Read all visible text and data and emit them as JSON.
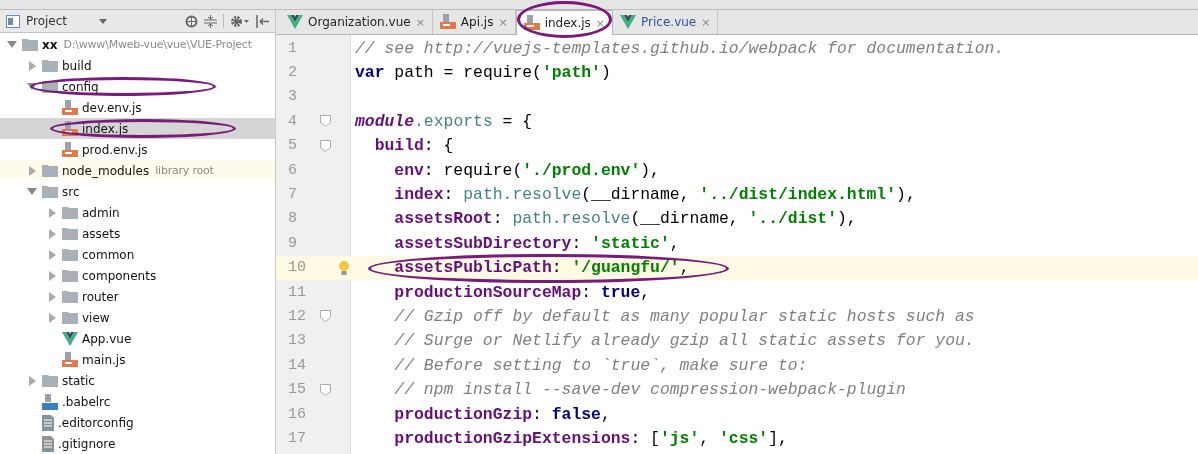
{
  "project_panel": {
    "title": "Project"
  },
  "tree": [
    {
      "name": "xx",
      "kind": "folder",
      "expanded": true,
      "selected": false,
      "circled": false,
      "note": "D:\\www\\Mweb-vue\\vue\\VUE-Project",
      "children": [
        {
          "name": "build",
          "kind": "folder",
          "expanded": false,
          "selected": false,
          "circled": false
        },
        {
          "name": "config",
          "kind": "folder",
          "expanded": true,
          "selected": false,
          "circled": true,
          "children": [
            {
              "name": "dev.env.js",
              "kind": "js",
              "selected": false,
              "circled": false
            },
            {
              "name": "index.js",
              "kind": "js",
              "selected": true,
              "circled": true
            },
            {
              "name": "prod.env.js",
              "kind": "js",
              "selected": false,
              "circled": false
            }
          ]
        },
        {
          "name": "node_modules",
          "kind": "folder",
          "expanded": false,
          "selected": false,
          "circled": false,
          "note": "library root"
        },
        {
          "name": "src",
          "kind": "folder",
          "expanded": true,
          "selected": false,
          "circled": false,
          "children": [
            {
              "name": "admin",
              "kind": "folder",
              "expanded": false,
              "selected": false,
              "circled": false
            },
            {
              "name": "assets",
              "kind": "folder",
              "expanded": false,
              "selected": false,
              "circled": false
            },
            {
              "name": "common",
              "kind": "folder",
              "expanded": false,
              "selected": false,
              "circled": false
            },
            {
              "name": "components",
              "kind": "folder",
              "expanded": false,
              "selected": false,
              "circled": false
            },
            {
              "name": "router",
              "kind": "folder",
              "expanded": false,
              "selected": false,
              "circled": false
            },
            {
              "name": "view",
              "kind": "folder",
              "expanded": false,
              "selected": false,
              "circled": false
            },
            {
              "name": "App.vue",
              "kind": "vue",
              "selected": false,
              "circled": false
            },
            {
              "name": "main.js",
              "kind": "js",
              "selected": false,
              "circled": false
            }
          ]
        },
        {
          "name": "static",
          "kind": "folder",
          "expanded": false,
          "selected": false,
          "circled": false
        },
        {
          "name": ".babelrc",
          "kind": "json",
          "selected": false,
          "circled": false
        },
        {
          "name": ".editorconfig",
          "kind": "text",
          "selected": false,
          "circled": false
        },
        {
          "name": ".gitignore",
          "kind": "text",
          "selected": false,
          "circled": false
        }
      ]
    }
  ],
  "tabs": [
    {
      "label": "Organization.vue",
      "kind": "vue",
      "selected": false,
      "circled": false,
      "close": "×"
    },
    {
      "label": "Api.js",
      "kind": "js",
      "selected": false,
      "circled": false,
      "close": "×"
    },
    {
      "label": "index.js",
      "kind": "js",
      "selected": true,
      "circled": true,
      "close": "×"
    },
    {
      "label": "Price.vue",
      "kind": "vue",
      "selected": false,
      "circled": false,
      "close": "×"
    }
  ],
  "code_lines": [
    {
      "number": "1",
      "current": false,
      "circled": false,
      "fold": false,
      "segments": [
        {
          "text": "// see http://vuejs-templates.github.io/webpack for documentation.",
          "kind": "comment"
        }
      ]
    },
    {
      "number": "2",
      "current": false,
      "circled": false,
      "fold": false,
      "segments": [
        {
          "text": "var",
          "kind": "keyword"
        },
        {
          "text": " path = require(",
          "kind": "plain"
        },
        {
          "text": "'path'",
          "kind": "string"
        },
        {
          "text": ")",
          "kind": "plain"
        }
      ]
    },
    {
      "number": "3",
      "current": false,
      "circled": false,
      "fold": false
    },
    {
      "number": "4",
      "current": false,
      "circled": false,
      "fold": true,
      "segments": [
        {
          "text": "module",
          "kind": "global"
        },
        {
          "text": ".exports",
          "kind": "member"
        },
        {
          "text": " = {",
          "kind": "plain"
        }
      ]
    },
    {
      "number": "5",
      "current": false,
      "circled": false,
      "fold": true,
      "segments": [
        {
          "text": "  build",
          "kind": "property"
        },
        {
          "text": ": {",
          "kind": "plain"
        }
      ]
    },
    {
      "number": "6",
      "current": false,
      "circled": false,
      "fold": false,
      "segments": [
        {
          "text": "    env",
          "kind": "property"
        },
        {
          "text": ": require(",
          "kind": "plain"
        },
        {
          "text": "'./prod.env'",
          "kind": "string"
        },
        {
          "text": "),",
          "kind": "plain"
        }
      ]
    },
    {
      "number": "7",
      "current": false,
      "circled": false,
      "fold": false,
      "segments": [
        {
          "text": "    index",
          "kind": "property"
        },
        {
          "text": ": ",
          "kind": "plain"
        },
        {
          "text": "path.resolve",
          "kind": "member"
        },
        {
          "text": "(__dirname, ",
          "kind": "plain"
        },
        {
          "text": "'../dist/index.html'",
          "kind": "string"
        },
        {
          "text": "),",
          "kind": "plain"
        }
      ]
    },
    {
      "number": "8",
      "current": false,
      "circled": false,
      "fold": false,
      "segments": [
        {
          "text": "    assetsRoot",
          "kind": "property"
        },
        {
          "text": ": ",
          "kind": "plain"
        },
        {
          "text": "path.resolve",
          "kind": "member"
        },
        {
          "text": "(__dirname, ",
          "kind": "plain"
        },
        {
          "text": "'../dist'",
          "kind": "string"
        },
        {
          "text": "),",
          "kind": "plain"
        }
      ]
    },
    {
      "number": "9",
      "current": false,
      "circled": false,
      "fold": false,
      "segments": [
        {
          "text": "    assetsSubDirectory",
          "kind": "property"
        },
        {
          "text": ": ",
          "kind": "plain"
        },
        {
          "text": "'static'",
          "kind": "string"
        },
        {
          "text": ",",
          "kind": "plain"
        }
      ]
    },
    {
      "number": "10",
      "current": true,
      "circled": true,
      "fold": false,
      "segments": [
        {
          "text": "    assetsPublicPath",
          "kind": "property"
        },
        {
          "text": ": ",
          "kind": "plain"
        },
        {
          "text": "'/guangfu/'",
          "kind": "string"
        },
        {
          "text": ",",
          "kind": "plain"
        }
      ]
    },
    {
      "number": "11",
      "current": false,
      "circled": false,
      "fold": false,
      "segments": [
        {
          "text": "    productionSourceMap",
          "kind": "property"
        },
        {
          "text": ": ",
          "kind": "plain"
        },
        {
          "text": "true",
          "kind": "keyword"
        },
        {
          "text": ",",
          "kind": "plain"
        }
      ]
    },
    {
      "number": "12",
      "current": false,
      "circled": false,
      "fold": true,
      "segments": [
        {
          "text": "    // Gzip off by default as many popular static hosts such as",
          "kind": "comment"
        }
      ]
    },
    {
      "number": "13",
      "current": false,
      "circled": false,
      "fold": false,
      "segments": [
        {
          "text": "    // Surge or Netlify already gzip all static assets for you.",
          "kind": "comment"
        }
      ]
    },
    {
      "number": "14",
      "current": false,
      "circled": false,
      "fold": false,
      "segments": [
        {
          "text": "    // Before setting to `true`, make sure to:",
          "kind": "comment"
        }
      ]
    },
    {
      "number": "15",
      "current": false,
      "circled": false,
      "fold": true,
      "segments": [
        {
          "text": "    // npm install --save-dev compression-webpack-plugin",
          "kind": "comment"
        }
      ]
    },
    {
      "number": "16",
      "current": false,
      "circled": false,
      "fold": false,
      "segments": [
        {
          "text": "    productionGzip",
          "kind": "property"
        },
        {
          "text": ": ",
          "kind": "plain"
        },
        {
          "text": "false",
          "kind": "keyword"
        },
        {
          "text": ",",
          "kind": "plain"
        }
      ]
    },
    {
      "number": "17",
      "current": false,
      "circled": false,
      "fold": false,
      "segments": [
        {
          "text": "    productionGzipExtensions",
          "kind": "property"
        },
        {
          "text": ": [",
          "kind": "plain"
        },
        {
          "text": "'js'",
          "kind": "string"
        },
        {
          "text": ", ",
          "kind": "plain"
        },
        {
          "text": "'css'",
          "kind": "string"
        },
        {
          "text": "],",
          "kind": "plain"
        }
      ]
    }
  ]
}
